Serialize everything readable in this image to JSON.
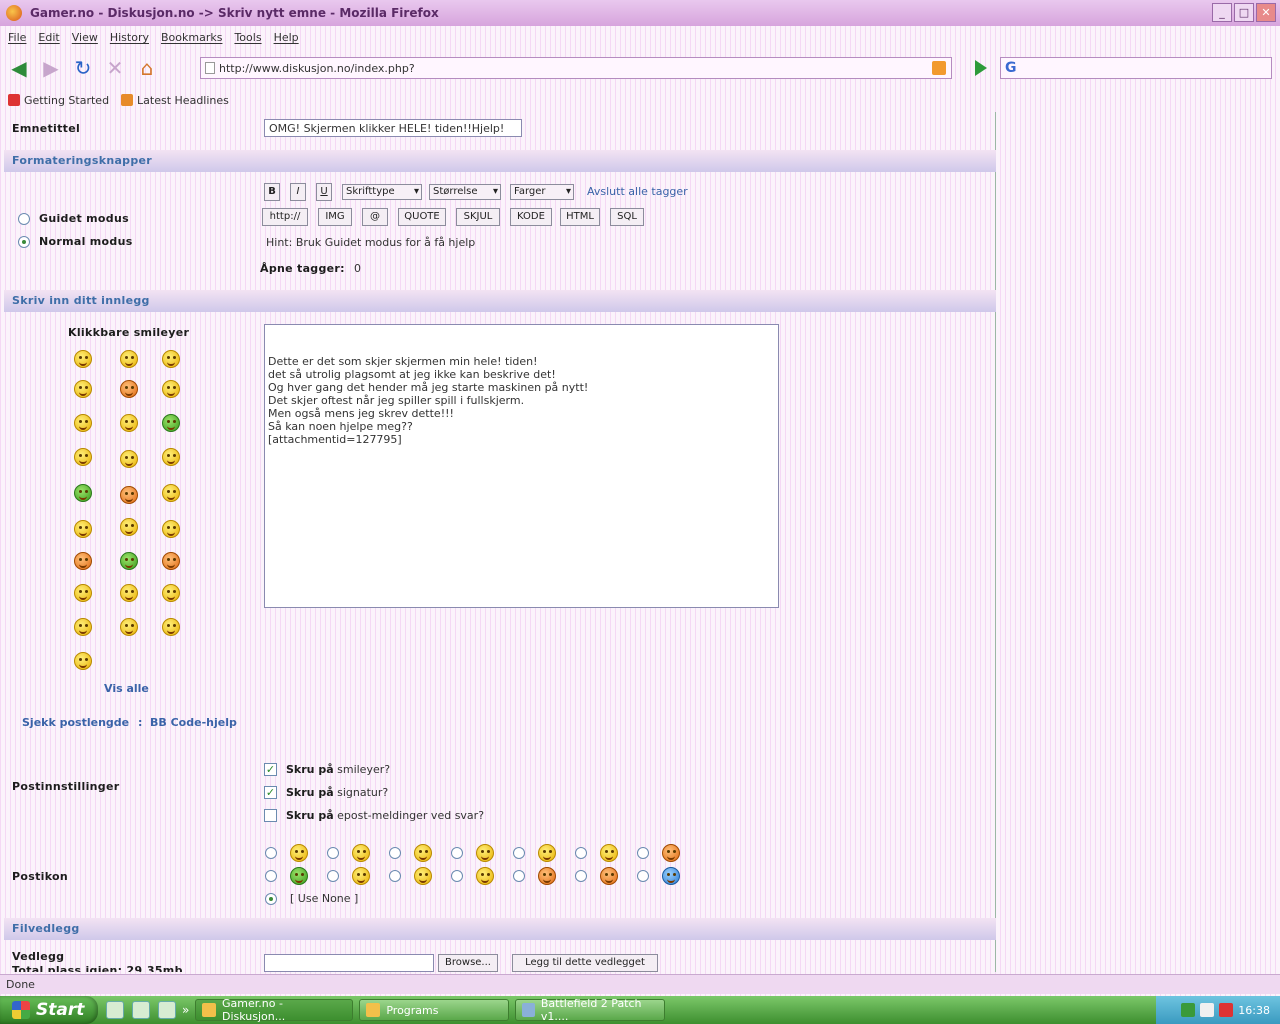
{
  "window": {
    "title": "Gamer.no - Diskusjon.no -> Skriv nytt emne - Mozilla Firefox",
    "minimize": "_",
    "maximize": "□",
    "close": "✕"
  },
  "menu": [
    "File",
    "Edit",
    "View",
    "History",
    "Bookmarks",
    "Tools",
    "Help"
  ],
  "nav": {
    "url": "http://www.diskusjon.no/index.php?"
  },
  "bookmarks": [
    "Getting Started",
    "Latest Headlines"
  ],
  "form": {
    "subject_label": "Emnetittel",
    "subject_value": "OMG! Skjermen klikker HELE! tiden!!Hjelp!",
    "formatting_header": "Formateringsknapper",
    "bold": "B",
    "italic": "I",
    "underline": "U",
    "font_select": "Skrifttype",
    "size_select": "Størrelse",
    "color_select": "Farger",
    "close_tags": "Avslutt alle tagger",
    "tag_buttons": [
      "http://",
      "IMG",
      "@",
      "QUOTE",
      "SKJUL",
      "KODE",
      "HTML",
      "SQL"
    ],
    "guided_mode": "Guidet modus",
    "normal_mode": "Normal modus",
    "hint": "Hint: Bruk Guidet modus for å få hjelp",
    "open_tags_label": "Åpne tagger:",
    "open_tags_value": "0",
    "post_header": "Skriv inn ditt innlegg",
    "smileys_title": "Klikkbare smileyer",
    "show_all": "Vis alle",
    "check_length": "Sjekk postlengde",
    "separator": ":",
    "bbcode_help": "BB Code-hjelp",
    "message_lines": [
      "Dette er det som skjer skjermen min hele! tiden!",
      "det så utrolig plagsomt at jeg ikke kan beskrive det!",
      "Og hver gang det hender må jeg starte maskinen på nytt!",
      "Det skjer oftest når jeg spiller spill i fullskjerm.",
      "Men også mens jeg skrev dette!!!",
      "Så kan noen hjelpe meg??",
      "",
      "[attachmentid=127795]"
    ],
    "post_settings_label": "Postinnstillinger",
    "opt_smileys_bold": "Skru på",
    "opt_smileys_rest": "smileyer?",
    "opt_signature_bold": "Skru på",
    "opt_signature_rest": "signatur?",
    "opt_email_bold": "Skru på",
    "opt_email_rest": "epost-meldinger ved svar?",
    "post_icon_label": "Postikon",
    "use_none": "[ Use None ]",
    "attachments_header": "Filvedlegg",
    "attachment_label": "Vedlegg",
    "total_space": "Total plass igjen: 29.35mb",
    "browse": "Browse...",
    "add_attachment": "Legg til dette vedlegget"
  },
  "status": "Done",
  "taskbar": {
    "start": "Start",
    "more": "»",
    "tasks": [
      "Gamer.no - Diskusjon...",
      "Programs",
      "Battlefield 2 Patch v1...."
    ],
    "clock": "16:38"
  },
  "colors": {
    "accent": "#3f6ea8",
    "taskbar": "#3d8f2f",
    "background": "#fbf3fb"
  }
}
